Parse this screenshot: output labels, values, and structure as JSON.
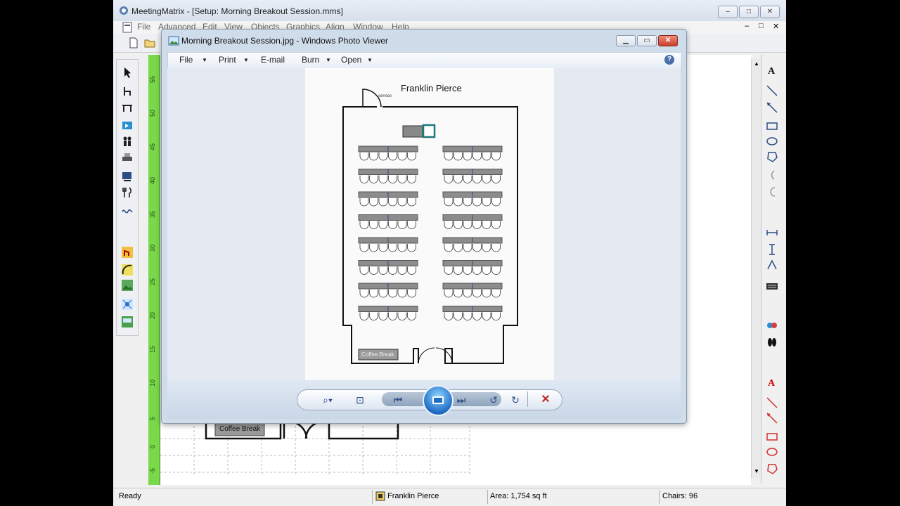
{
  "app": {
    "title": "MeetingMatrix - [Setup: Morning Breakout Session.mms]",
    "menu": [
      "File",
      "Advanced",
      "Edit",
      "View",
      "Objects",
      "Graphics",
      "Align",
      "Window",
      "Help"
    ],
    "caption_buttons": {
      "minimize": "–",
      "restore": "□",
      "close": "✕"
    },
    "mdi_buttons": {
      "minimize": "–",
      "restore": "□",
      "close": "✕"
    }
  },
  "ruler": {
    "labels": [
      "55",
      "50",
      "45",
      "40",
      "35",
      "30",
      "25",
      "20",
      "15",
      "10",
      "5",
      "0",
      "-5"
    ]
  },
  "canvas_behind": {
    "coffee_break_label": "Coffee Break"
  },
  "status": {
    "ready": "Ready",
    "room": "Franklin Pierce",
    "area": "Area: 1,754 sq ft",
    "chairs": "Chairs: 96"
  },
  "viewer": {
    "title": "Morning Breakout Session.jpg - Windows Photo Viewer",
    "menu": {
      "file": "File",
      "print": "Print",
      "email": "E-mail",
      "burn": "Burn",
      "open": "Open"
    },
    "help_icon_label": "?",
    "image": {
      "room_title": "Franklin Pierce",
      "service_label": "service",
      "coffee_break_label": "Coffee Break",
      "table_rows": 8,
      "columns": 2,
      "chairs_per_table": 6
    },
    "controls": [
      "zoom-icon",
      "fit-icon",
      "previous-icon",
      "slideshow-icon",
      "next-icon",
      "rotate-ccw-icon",
      "rotate-cw-icon",
      "delete-icon"
    ]
  },
  "colors": {
    "ruler": "#7ad84b",
    "accent": "#1f6cc4",
    "close_red": "#d04030"
  }
}
